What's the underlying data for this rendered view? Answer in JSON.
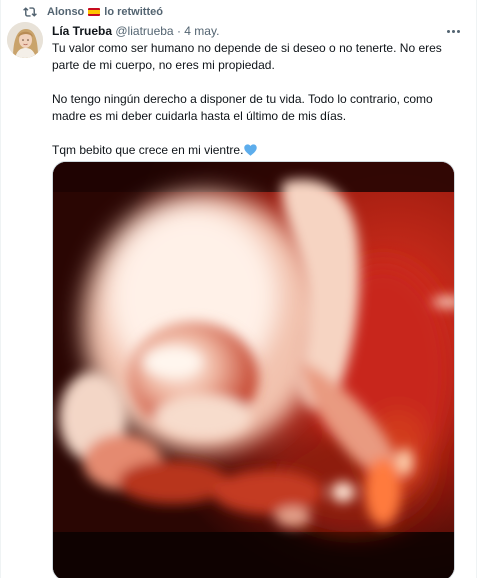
{
  "social_context": {
    "retweeter": "Alonso",
    "flag_icon": "spain-flag-icon",
    "action": "lo retwitteó"
  },
  "tweet": {
    "author_name": "Lía Trueba",
    "handle": "@liatrueba",
    "separator": "·",
    "date": "4 may.",
    "paragraphs": [
      "Tu valor como ser humano no depende de si deseo o no tenerte. No eres parte de mi cuerpo, no eres mi propiedad.",
      "No tengo ningún derecho a disponer de tu vida. Todo lo contrario, como madre es mi deber cuidarla hasta el último de mis días.",
      "Tqm bebito que crece en mi vientre."
    ],
    "emoji": "blue-heart-icon"
  },
  "colors": {
    "text_primary": "#0f1419",
    "text_secondary": "#536471",
    "heart_blue": "#5dadec",
    "media_red": "#c8281a"
  }
}
